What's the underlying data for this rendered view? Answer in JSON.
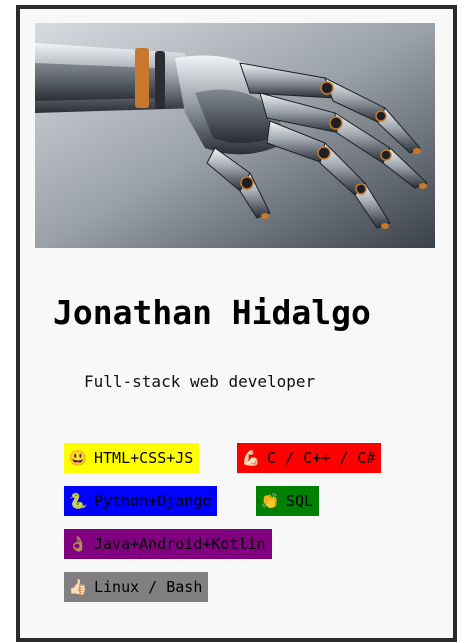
{
  "profile": {
    "name": "Jonathan Hidalgo",
    "role": "Full-stack web developer",
    "hero_image": "robotic-hand-image"
  },
  "skills": [
    {
      "emoji": "😃",
      "label": "HTML+CSS+JS",
      "color": "#ffff00"
    },
    {
      "emoji": "💪🏻",
      "label": "C / C++ / C#",
      "color": "#ff0000"
    },
    {
      "emoji": "🐍",
      "label": "Python+Django",
      "color": "#0000ff"
    },
    {
      "emoji": "👏",
      "label": "SQL",
      "color": "#008000"
    },
    {
      "emoji": "👌🏽",
      "label": "Java+Android+Kotlin",
      "color": "#800080"
    },
    {
      "emoji": "👍🏻",
      "label": "Linux / Bash",
      "color": "#808080"
    }
  ]
}
